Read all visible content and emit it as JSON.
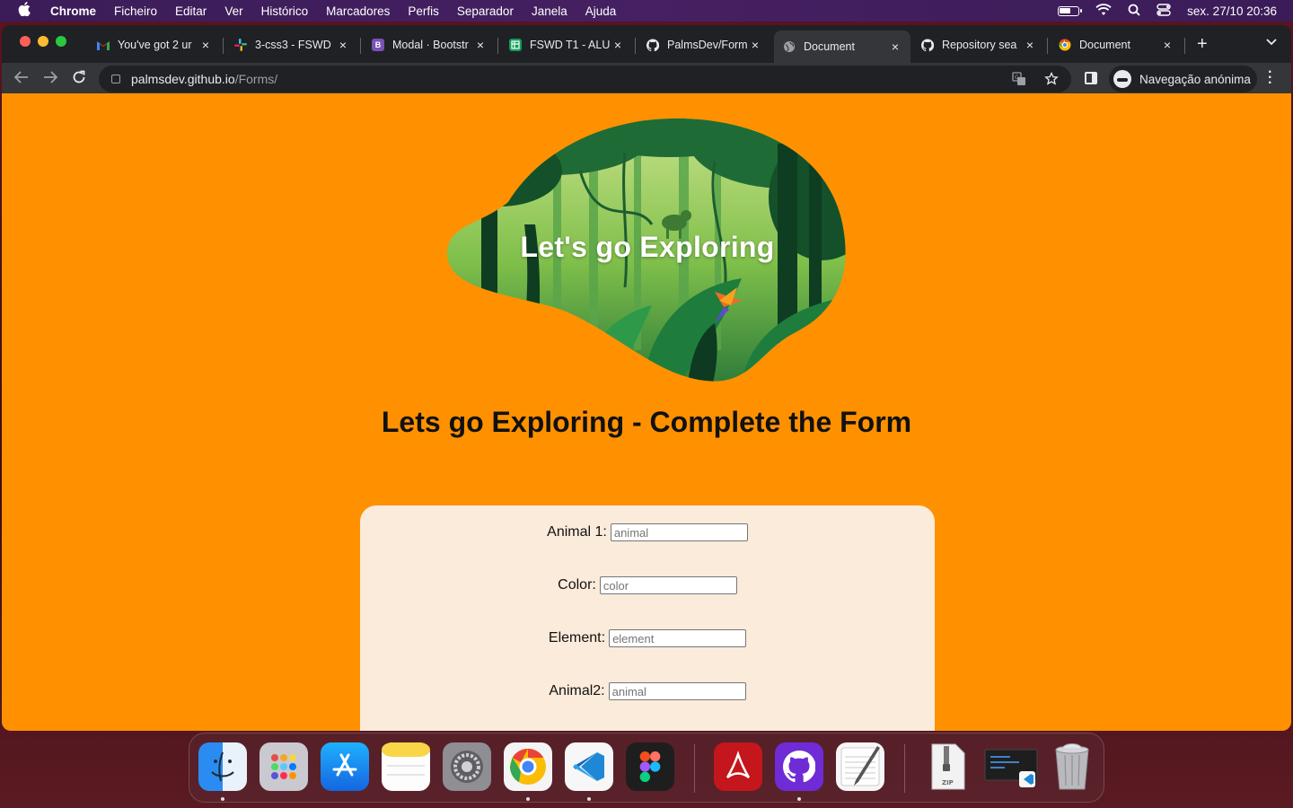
{
  "menubar": {
    "app": "Chrome",
    "items": [
      "Ficheiro",
      "Editar",
      "Ver",
      "Histórico",
      "Marcadores",
      "Perfis",
      "Separador",
      "Janela",
      "Ajuda"
    ],
    "datetime": "sex. 27/10  20:36"
  },
  "tabs": [
    {
      "title": "You've got 2 ur",
      "icon": "gmail-icon",
      "color": "#ea4335"
    },
    {
      "title": "3-css3 - FSWD",
      "icon": "slack-icon",
      "color": "#e01e5a"
    },
    {
      "title": "Modal · Bootstr",
      "icon": "bootstrap-icon",
      "color": "#7952b3"
    },
    {
      "title": "FSWD T1 - ALU",
      "icon": "sheets-icon",
      "color": "#0f9d58"
    },
    {
      "title": "PalmsDev/Form",
      "icon": "github-icon",
      "color": "#e8eaed"
    },
    {
      "title": "Document",
      "icon": "globe-icon",
      "color": "#9aa0a6"
    },
    {
      "title": "Repository sea",
      "icon": "github-icon",
      "color": "#e8eaed"
    },
    {
      "title": "Document",
      "icon": "chrome-icon",
      "color": "#fbbc04"
    }
  ],
  "address": {
    "host": "palmsdev.github.io",
    "path": "/Forms/"
  },
  "incognito_label": "Navegação anónima",
  "page": {
    "hero_title": "Let's go Exploring",
    "heading": "Lets go Exploring - Complete the Form",
    "fields": [
      {
        "label": "Animal 1:",
        "placeholder": "animal"
      },
      {
        "label": "Color:",
        "placeholder": "color"
      },
      {
        "label": "Element:",
        "placeholder": "element"
      },
      {
        "label": "Animal2:",
        "placeholder": "animal"
      }
    ]
  },
  "dock": {
    "apps": [
      "Finder",
      "Launchpad",
      "App Store",
      "Notes",
      "System Preferences",
      "Chrome",
      "VS Code",
      "Figma",
      "Acrobat",
      "GitHub Desktop",
      "TextEdit",
      "Archive",
      "Screenshot",
      "Trash"
    ]
  },
  "colors": {
    "page_bg": "#ff9100",
    "card_bg": "#fbebda"
  }
}
